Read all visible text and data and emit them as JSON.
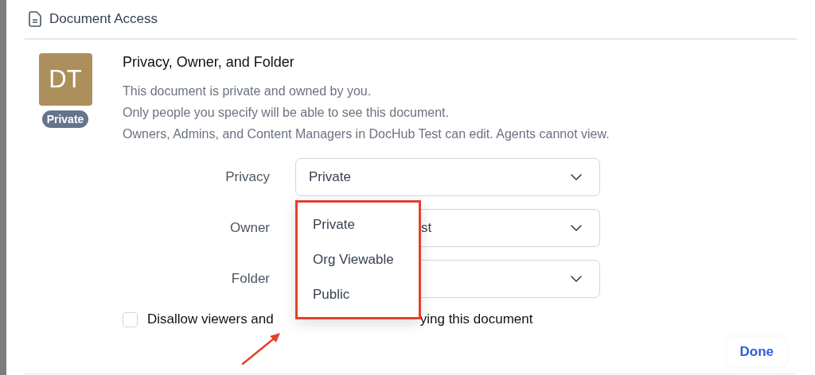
{
  "header": {
    "title": "Document Access"
  },
  "avatar": {
    "initials": "DT",
    "color": "#ad8f5c",
    "badge": "Private"
  },
  "section": {
    "title": "Privacy, Owner, and Folder",
    "lines": [
      "This document is private and owned by you.",
      "Only people you specify will be able to see this document.",
      "Owners, Admins, and Content Managers in DocHub Test can edit. Agents cannot view."
    ]
  },
  "fields": [
    {
      "label": "Privacy",
      "value": "Private",
      "partly_hidden": false
    },
    {
      "label": "Owner",
      "value": "st",
      "partly_hidden": true
    },
    {
      "label": "Folder"
    }
  ],
  "menu": {
    "open": true,
    "options": [
      {
        "label": "Private"
      },
      {
        "label": "Org Viewable"
      },
      {
        "label": "Public"
      }
    ]
  },
  "checkbox": {
    "checked": false,
    "label_parts": [
      "Disallow viewers and",
      "ying this document"
    ]
  },
  "done_button": "Done"
}
